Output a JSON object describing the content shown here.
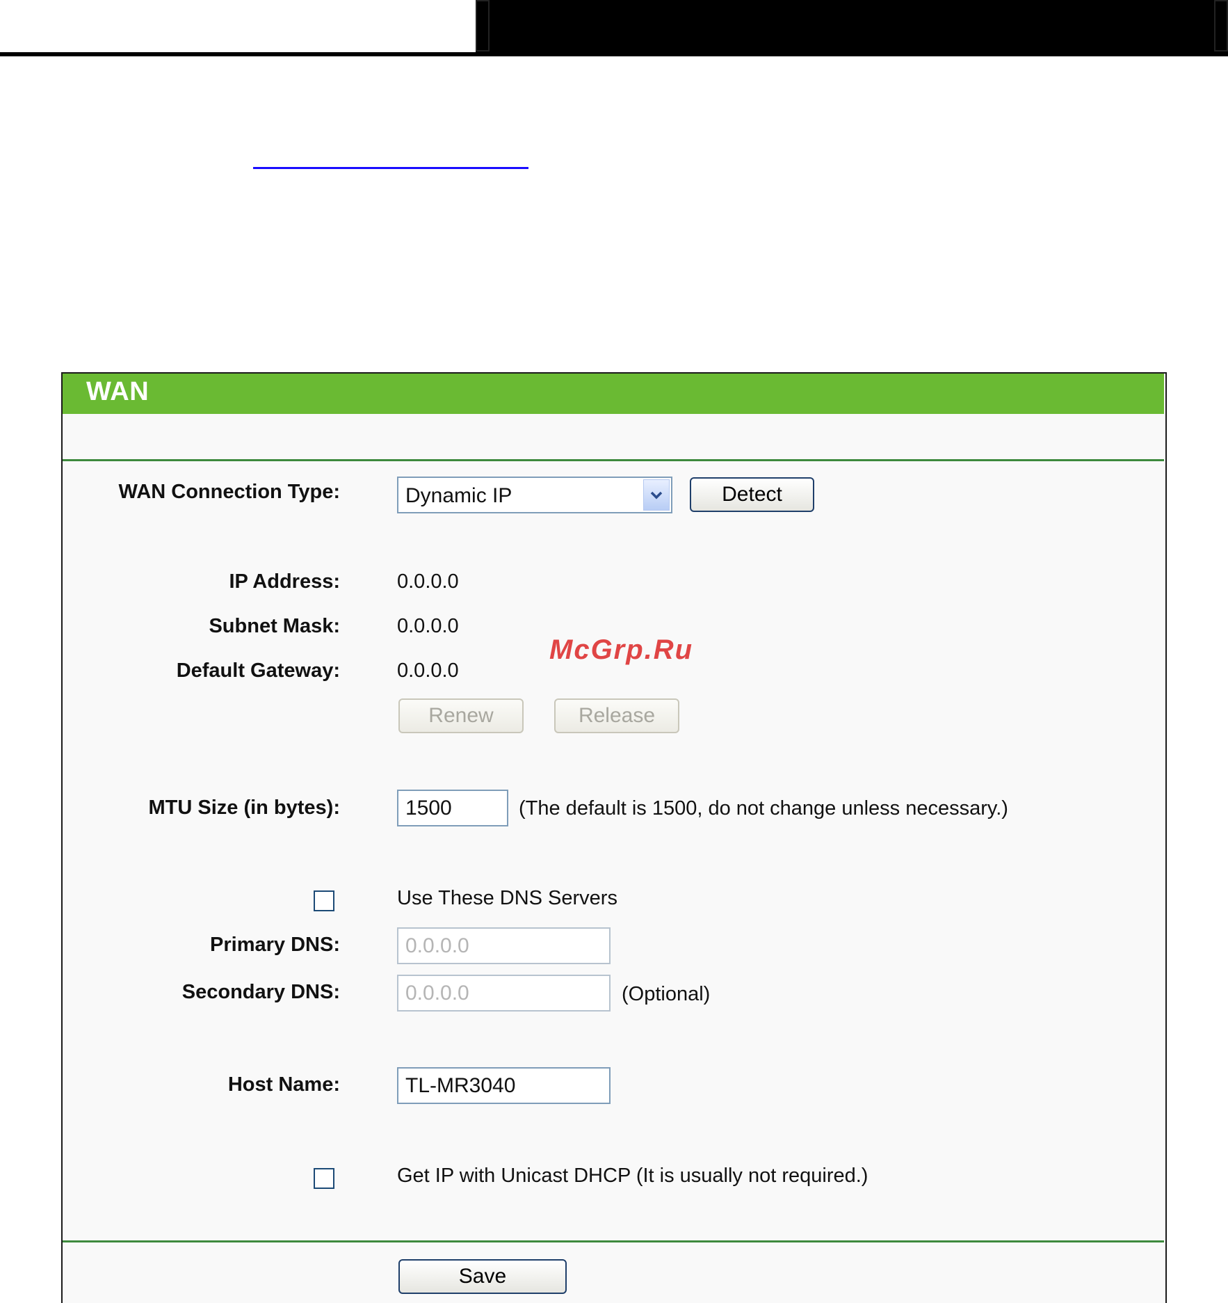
{
  "panel": {
    "title": "WAN"
  },
  "fields": {
    "connection_type_label": "WAN Connection Type:",
    "connection_type_value": "Dynamic IP",
    "detect_label": "Detect",
    "ip_address_label": "IP Address:",
    "ip_address_value": "0.0.0.0",
    "subnet_mask_label": "Subnet Mask:",
    "subnet_mask_value": "0.0.0.0",
    "default_gateway_label": "Default Gateway:",
    "default_gateway_value": "0.0.0.0",
    "renew_label": "Renew",
    "release_label": "Release",
    "mtu_label": "MTU Size (in bytes):",
    "mtu_value": "1500",
    "mtu_note": "(The default is 1500, do not change unless necessary.)",
    "use_dns_label": "Use These DNS Servers",
    "primary_dns_label": "Primary DNS:",
    "primary_dns_value": "0.0.0.0",
    "secondary_dns_label": "Secondary DNS:",
    "secondary_dns_value": "0.0.0.0",
    "secondary_dns_note": "(Optional)",
    "host_name_label": "Host Name:",
    "host_name_value": "TL-MR3040",
    "unicast_dhcp_label": "Get IP with Unicast DHCP (It is usually not required.)",
    "save_label": "Save"
  },
  "watermark": "McGrp.Ru",
  "colors": {
    "title_bar": "#6aba33",
    "rule": "#3d8a3d",
    "panel_bg": "#f9f9f9",
    "input_border": "#7f9db9",
    "watermark": "#e04545"
  },
  "icons": {
    "select_arrow": "chevron-down-icon"
  }
}
